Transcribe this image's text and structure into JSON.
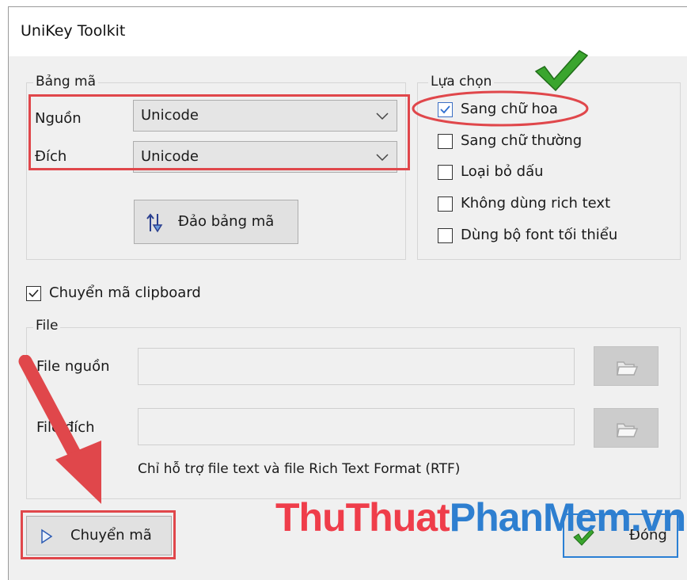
{
  "window": {
    "title": "UniKey Toolkit"
  },
  "encoding_group": {
    "legend": "Bảng mã",
    "source_label": "Nguồn",
    "source_value": "Unicode",
    "target_label": "Đích",
    "target_value": "Unicode",
    "swap_button": "Đảo bảng mã"
  },
  "options_group": {
    "legend": "Lựa chọn",
    "items": [
      {
        "label": "Sang chữ hoa",
        "checked": true
      },
      {
        "label": "Sang chữ thường",
        "checked": false
      },
      {
        "label": "Loại bỏ dấu",
        "checked": false
      },
      {
        "label": "Không dùng rich text",
        "checked": false
      },
      {
        "label": "Dùng bộ font tối thiểu",
        "checked": false
      }
    ]
  },
  "clipboard": {
    "label": "Chuyển mã clipboard",
    "checked": true
  },
  "file_group": {
    "legend": "File",
    "source_label": "File nguồn",
    "target_label": "File đích",
    "source_value": "",
    "target_value": "",
    "note": "Chỉ hỗ trợ file text và file Rich Text Format (RTF)"
  },
  "actions": {
    "convert": "Chuyển mã",
    "close": "Đóng"
  },
  "watermark": {
    "part1": "ThuThuat",
    "part2": "PhanMem",
    "part3": ".vn"
  },
  "colors": {
    "annotation_red": "#e0474b",
    "check_green": "#3aa52e",
    "watermark_red": "#ef3d4a",
    "watermark_blue": "#2e7fd0"
  }
}
